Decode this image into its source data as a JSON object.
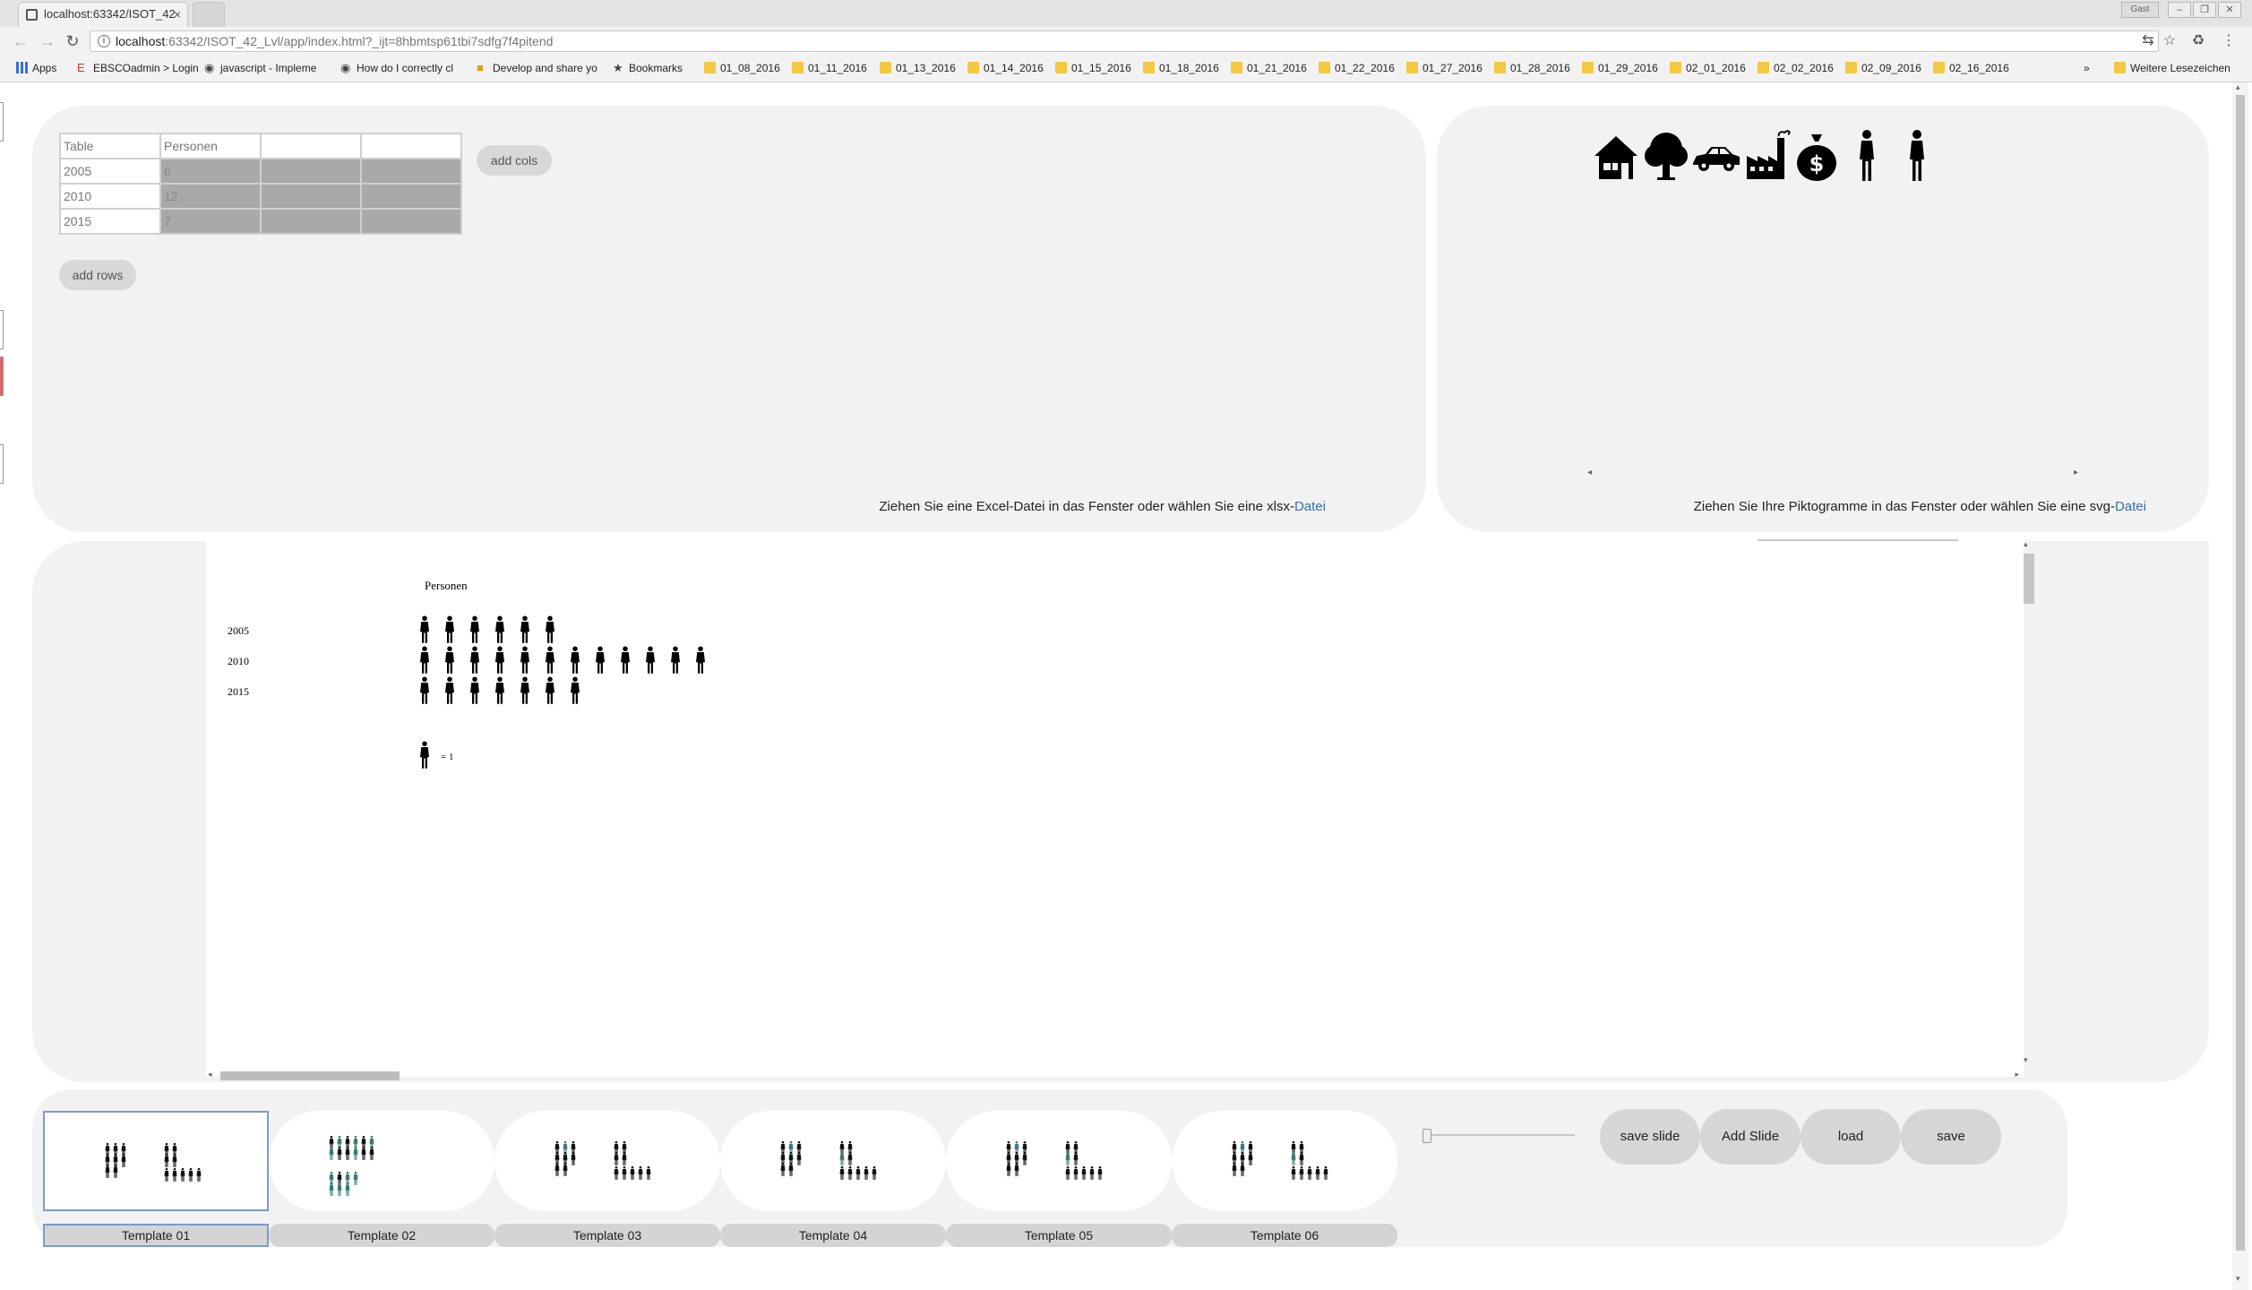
{
  "browser": {
    "tab_title": "localhost:63342/ISOT_42",
    "tab_close": "×",
    "profile": "Gast",
    "url_host": "localhost",
    "url_path": ":63342/ISOT_42_Lvl/app/index.html?_ijt=8hbmtsp61tbi7sdfg7f4pitend",
    "bookmarks": [
      "Apps",
      "EBSCOadmin > Login",
      "javascript - Impleme",
      "How do I correctly cl",
      "Develop and share yo",
      "Bookmarks",
      "01_08_2016",
      "01_11_2016",
      "01_13_2016",
      "01_14_2016",
      "01_15_2016",
      "01_18_2016",
      "01_21_2016",
      "01_22_2016",
      "01_27_2016",
      "01_28_2016",
      "01_29_2016",
      "02_01_2016",
      "02_02_2016",
      "02_09_2016",
      "02_16_2016"
    ],
    "bookmarks_overflow": "»",
    "other_bookmarks": "Weitere Lesezeichen"
  },
  "table_panel": {
    "rows": [
      [
        "Table",
        "Personen",
        "",
        ""
      ],
      [
        "2005",
        "6",
        "",
        ""
      ],
      [
        "2010",
        "12",
        "",
        ""
      ],
      [
        "2015",
        "7",
        "",
        ""
      ]
    ],
    "add_cols": "add cols",
    "add_rows": "add rows",
    "hint_text": "Ziehen Sie eine Excel-Datei in das Fenster oder wählen Sie eine xlsx-",
    "hint_link": "Datei"
  },
  "icon_panel": {
    "icons": [
      "house-icon",
      "tree-icon",
      "car-icon",
      "factory-icon",
      "money-bag-icon",
      "person-icon",
      "person-icon"
    ],
    "hint_text": "Ziehen Sie Ihre Piktogramme in das Fenster oder wählen Sie eine svg-",
    "hint_link": "Datei"
  },
  "chart_data": {
    "type": "pictogram",
    "title": "Personen",
    "categories": [
      "2005",
      "2010",
      "2015"
    ],
    "values": [
      6,
      12,
      7
    ],
    "unit_icon": "person-icon",
    "legend": "= 1",
    "colors": {
      "icon": "#000000"
    }
  },
  "templates": [
    {
      "label": "Template 01",
      "selected": true
    },
    {
      "label": "Template 02",
      "selected": false
    },
    {
      "label": "Template 03",
      "selected": false
    },
    {
      "label": "Template 04",
      "selected": false
    },
    {
      "label": "Template 05",
      "selected": false
    },
    {
      "label": "Template 06",
      "selected": false
    }
  ],
  "slider": {
    "value": 0
  },
  "actions": {
    "save_slide": "save slide",
    "add_slide": "Add Slide",
    "load": "load",
    "save": "save"
  },
  "colors": {
    "panel_bg": "#f2f2f2",
    "link": "#3a6fb0",
    "cell_filled": "#a9a9a9",
    "selected_outline": "#7a9cd0",
    "mini_teal": "#3c7a78"
  }
}
